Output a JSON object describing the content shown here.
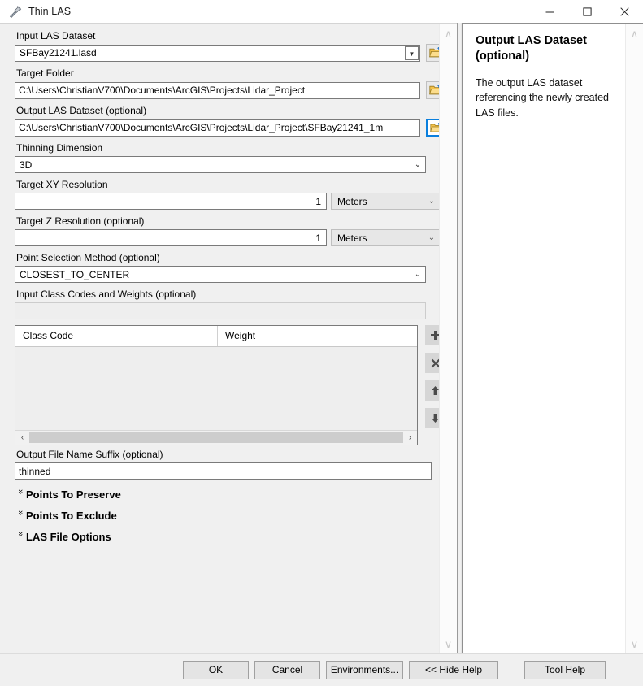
{
  "window": {
    "title": "Thin LAS",
    "icon": "hammer-tool-icon",
    "minimize_label": "—",
    "maximize_label": "□",
    "close_label": "✕"
  },
  "form": {
    "input_las_dataset": {
      "label": "Input LAS Dataset",
      "value": "SFBay21241.lasd",
      "browse_icon": "open-folder-icon"
    },
    "target_folder": {
      "label": "Target Folder",
      "value": "C:\\Users\\ChristianV700\\Documents\\ArcGIS\\Projects\\Lidar_Project",
      "browse_icon": "open-folder-icon"
    },
    "output_las_dataset": {
      "label": "Output LAS Dataset (optional)",
      "value": "C:\\Users\\ChristianV700\\Documents\\ArcGIS\\Projects\\Lidar_Project\\SFBay21241_1m",
      "browse_icon": "open-folder-icon"
    },
    "thinning_dimension": {
      "label": "Thinning Dimension",
      "value": "3D"
    },
    "target_xy_resolution": {
      "label": "Target XY Resolution",
      "value": "1",
      "unit": "Meters"
    },
    "target_z_resolution": {
      "label": "Target Z Resolution (optional)",
      "value": "1",
      "unit": "Meters"
    },
    "point_selection_method": {
      "label": "Point Selection Method (optional)",
      "value": "CLOSEST_TO_CENTER"
    },
    "input_class_codes": {
      "label": "Input Class Codes and Weights (optional)",
      "value": ""
    },
    "class_table": {
      "columns": [
        "Class Code",
        "Weight"
      ],
      "rows": [],
      "buttons": [
        {
          "name": "add-row-button",
          "glyph": "✚",
          "icon": "plus-icon"
        },
        {
          "name": "delete-row-button",
          "glyph": "✕",
          "icon": "close-x-icon"
        },
        {
          "name": "move-up-button",
          "glyph": "⬆",
          "icon": "arrow-up-icon"
        },
        {
          "name": "move-down-button",
          "glyph": "⬇",
          "icon": "arrow-down-icon"
        }
      ],
      "hscroll_left": "‹",
      "hscroll_right": "›"
    },
    "output_file_suffix": {
      "label": "Output File Name Suffix (optional)",
      "value": "thinned"
    },
    "sections": [
      {
        "label": "Points To Preserve",
        "expanded": false,
        "chevron": "»"
      },
      {
        "label": "Points To Exclude",
        "expanded": false,
        "chevron": "»"
      },
      {
        "label": "LAS File Options",
        "expanded": false,
        "chevron": "»"
      }
    ]
  },
  "help": {
    "title": "Output LAS Dataset (optional)",
    "body": "The output LAS dataset referencing the newly created LAS files.",
    "scroll_up": "∧",
    "scroll_down": "∨"
  },
  "left_scroll": {
    "up": "∧",
    "down": "∨"
  },
  "footer": {
    "ok": "OK",
    "cancel": "Cancel",
    "environments": "Environments...",
    "hide_help": "<< Hide Help",
    "tool_help": "Tool Help"
  },
  "colors": {
    "dialog_background": "#f0f0f0",
    "field_background": "#ffffff",
    "field_border": "#7a7a7a",
    "focus_blue": "#0a7fdd",
    "button_face": "#e4e4e4",
    "folder_yellow": "#f5c342"
  }
}
